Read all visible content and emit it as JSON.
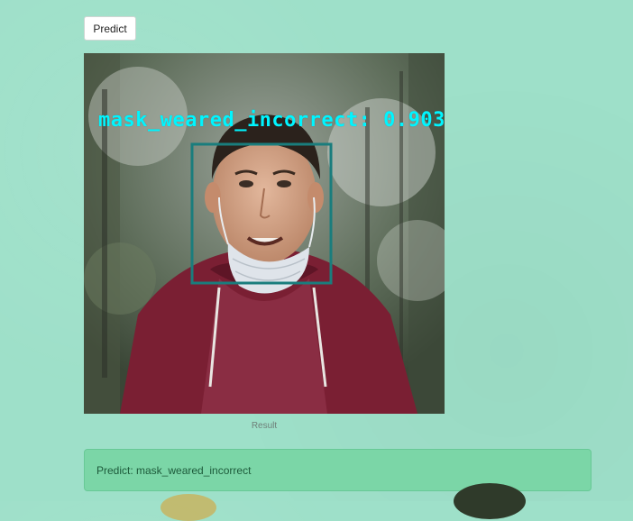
{
  "controls": {
    "predict_button_label": "Predict"
  },
  "result": {
    "detection_label": "mask_weared_incorrect: 0.903",
    "caption": "Result"
  },
  "alert": {
    "text": "Predict: mask_weared_incorrect"
  },
  "colors": {
    "background": "#9ee0c9",
    "detection_text": "#00f5ff",
    "bounding_box": "#1a7d7d",
    "alert_background": "#7bd6a7"
  }
}
